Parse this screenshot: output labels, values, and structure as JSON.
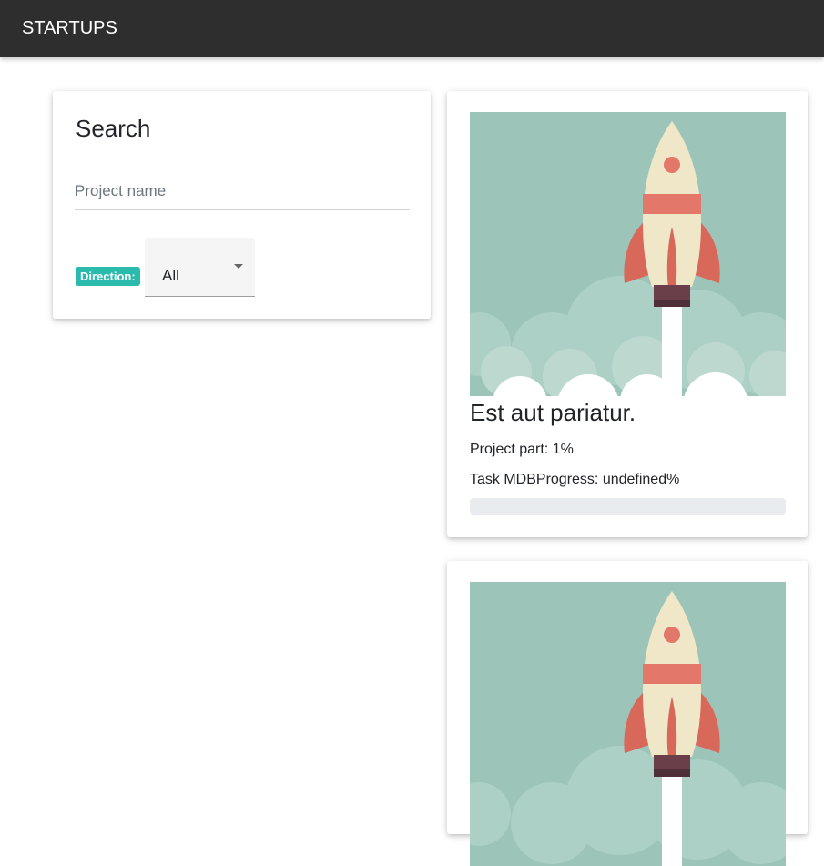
{
  "navbar": {
    "brand": "STARTUPS",
    "background": "#2e2e2e"
  },
  "search": {
    "title": "Search",
    "project_name_placeholder": "Project name",
    "project_name_value": "",
    "direction_label": "Direction:",
    "direction_selected": "All",
    "badge_color": "#2bbbad"
  },
  "projects": [
    {
      "image_icon": "rocket-illustration",
      "title": "Est aut pariatur.",
      "project_part": "Project part: 1%",
      "task_progress": "Task MDBProgress: undefined%",
      "progress_value": 0
    },
    {
      "image_icon": "rocket-illustration",
      "title": "",
      "project_part": "",
      "task_progress": "",
      "progress_value": 0
    }
  ]
}
